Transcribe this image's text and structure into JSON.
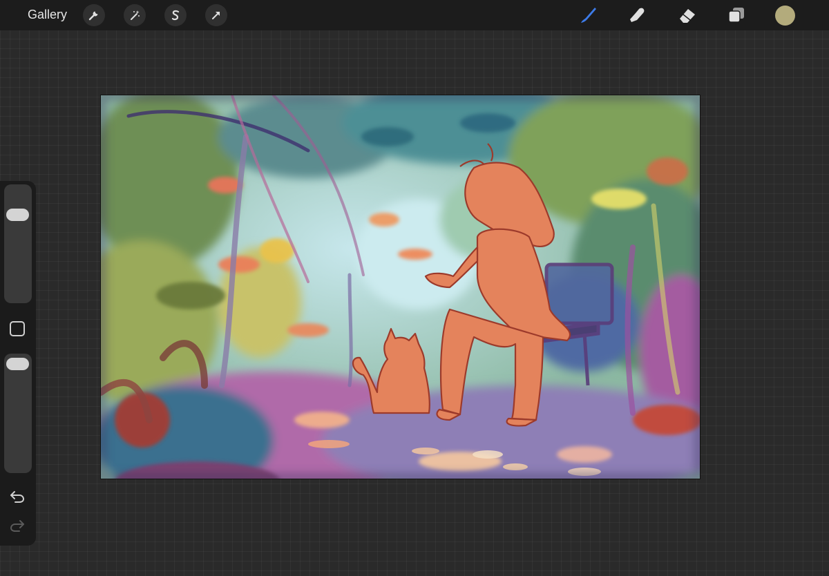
{
  "toolbar": {
    "gallery_label": "Gallery",
    "left_tools": [
      {
        "name": "actions",
        "icon": "wrench-icon"
      },
      {
        "name": "adjustments",
        "icon": "magic-wand-icon"
      },
      {
        "name": "selection",
        "icon": "selection-s-icon"
      },
      {
        "name": "transform",
        "icon": "arrow-cursor-icon"
      }
    ],
    "right_tools": [
      {
        "name": "brush",
        "icon": "brush-icon",
        "active": true
      },
      {
        "name": "smudge",
        "icon": "smudge-finger-icon"
      },
      {
        "name": "eraser",
        "icon": "eraser-icon"
      },
      {
        "name": "layers",
        "icon": "layers-icon"
      }
    ],
    "current_color": "#b3ab7c",
    "active_color": "#3d7be8"
  },
  "sidebar": {
    "brush_size_level": 0.8,
    "opacity_level": 1.0,
    "buttons": [
      "modifier-square-icon",
      "undo-icon",
      "redo-icon"
    ]
  },
  "canvas": {
    "content": "painting"
  }
}
